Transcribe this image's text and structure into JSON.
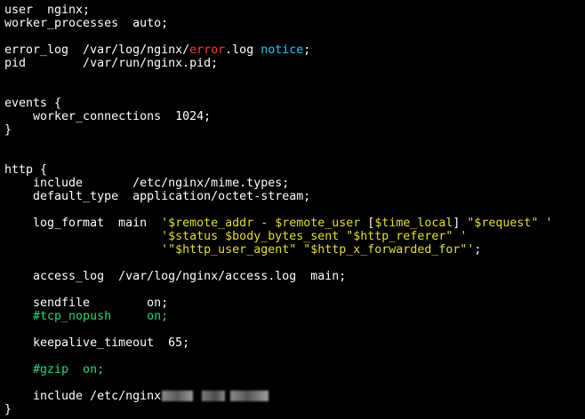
{
  "lines": [
    {
      "segments": [
        {
          "text": "user  nginx;",
          "color": "white"
        }
      ]
    },
    {
      "segments": [
        {
          "text": "worker_processes  auto;",
          "color": "white"
        }
      ]
    },
    {
      "segments": []
    },
    {
      "segments": [
        {
          "text": "error_log  /var/log/nginx/",
          "color": "white"
        },
        {
          "text": "error",
          "color": "red"
        },
        {
          "text": ".log ",
          "color": "white"
        },
        {
          "text": "notice",
          "color": "cyan"
        },
        {
          "text": ";",
          "color": "white"
        }
      ]
    },
    {
      "segments": [
        {
          "text": "pid        /var/run/nginx.pid;",
          "color": "white"
        }
      ]
    },
    {
      "segments": []
    },
    {
      "segments": []
    },
    {
      "segments": [
        {
          "text": "events {",
          "color": "white"
        }
      ]
    },
    {
      "segments": [
        {
          "text": "    worker_connections  1024;",
          "color": "white"
        }
      ]
    },
    {
      "segments": [
        {
          "text": "}",
          "color": "white"
        }
      ]
    },
    {
      "segments": []
    },
    {
      "segments": []
    },
    {
      "segments": [
        {
          "text": "http {",
          "color": "white"
        }
      ]
    },
    {
      "segments": [
        {
          "text": "    include       /etc/nginx/mime.types;",
          "color": "white"
        }
      ]
    },
    {
      "segments": [
        {
          "text": "    default_type  application/octet-stream;",
          "color": "white"
        }
      ]
    },
    {
      "segments": []
    },
    {
      "segments": [
        {
          "text": "    log_format  main  ",
          "color": "white"
        },
        {
          "text": "'$remote_addr - $remote_user ",
          "color": "yellow"
        },
        {
          "text": "[",
          "color": "white"
        },
        {
          "text": "$time_local",
          "color": "yellow"
        },
        {
          "text": "] ",
          "color": "white"
        },
        {
          "text": "\"$request\" '",
          "color": "yellow"
        }
      ]
    },
    {
      "segments": [
        {
          "text": "                      ",
          "color": "white"
        },
        {
          "text": "'$status $body_bytes_sent \"$http_referer\" '",
          "color": "yellow"
        }
      ]
    },
    {
      "segments": [
        {
          "text": "                      ",
          "color": "white"
        },
        {
          "text": "'\"$http_user_agent\" \"$http_x_forwarded_for\"'",
          "color": "yellow"
        },
        {
          "text": ";",
          "color": "white"
        }
      ]
    },
    {
      "segments": []
    },
    {
      "segments": [
        {
          "text": "    access_log  /var/log/nginx/access.log  main;",
          "color": "white"
        }
      ]
    },
    {
      "segments": []
    },
    {
      "segments": [
        {
          "text": "    sendfile        on;",
          "color": "white"
        }
      ]
    },
    {
      "segments": [
        {
          "text": "    #tcp_nopush",
          "color": "green"
        },
        {
          "text": "     ",
          "color": "white"
        },
        {
          "text": "on;",
          "color": "green"
        }
      ]
    },
    {
      "segments": []
    },
    {
      "segments": [
        {
          "text": "    keepalive_timeout  65;",
          "color": "white"
        }
      ]
    },
    {
      "segments": []
    },
    {
      "segments": [
        {
          "text": "    #gzip  on;",
          "color": "green"
        }
      ]
    },
    {
      "segments": []
    },
    {
      "segments": [
        {
          "text": "    include /etc/nginx",
          "color": "white"
        }
      ],
      "redacted": true
    },
    {
      "segments": [
        {
          "text": "}",
          "color": "white"
        }
      ]
    }
  ]
}
